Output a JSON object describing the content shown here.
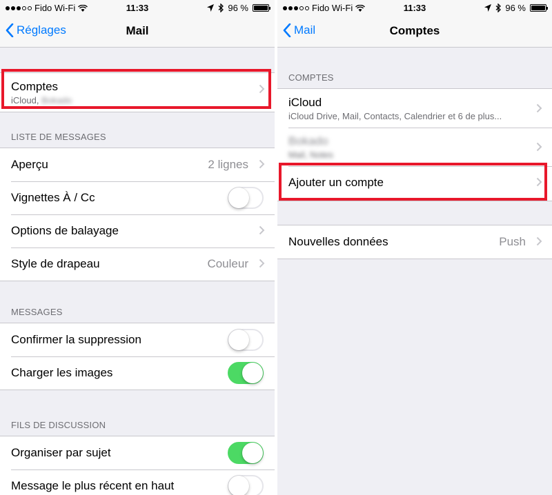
{
  "colors": {
    "accent": "#007aff",
    "switch_on": "#4cd964",
    "highlight": "#e8182b"
  },
  "left": {
    "status": {
      "carrier": "Fido Wi-Fi",
      "time": "11:33",
      "battery": "96 %",
      "battery_level": 0.96
    },
    "nav": {
      "back_label": "Réglages",
      "title": "Mail"
    },
    "accounts_row": {
      "label": "Comptes",
      "sublabel": "iCloud,",
      "sublabel_blurred": "Bokado"
    },
    "sections": {
      "message_list": {
        "header": "LISTE DE MESSAGES",
        "rows": [
          {
            "label": "Aperçu",
            "value": "2 lignes"
          },
          {
            "label": "Vignettes À / Cc",
            "toggle": false
          },
          {
            "label": "Options de balayage"
          },
          {
            "label": "Style de drapeau",
            "value": "Couleur"
          }
        ]
      },
      "messages": {
        "header": "MESSAGES",
        "rows": [
          {
            "label": "Confirmer la suppression",
            "toggle": false
          },
          {
            "label": "Charger les images",
            "toggle": true
          }
        ]
      },
      "threads": {
        "header": "FILS DE DISCUSSION",
        "rows": [
          {
            "label": "Organiser par sujet",
            "toggle": true
          },
          {
            "label": "Message le plus récent en haut",
            "toggle": false
          }
        ]
      }
    }
  },
  "right": {
    "status": {
      "carrier": "Fido Wi-Fi",
      "time": "11:33",
      "battery": "96 %",
      "battery_level": 0.96
    },
    "nav": {
      "back_label": "Mail",
      "title": "Comptes"
    },
    "accounts": {
      "header": "COMPTES",
      "icloud": {
        "label": "iCloud",
        "sublabel": "iCloud Drive, Mail, Contacts, Calendrier et 6 de plus..."
      },
      "blurred_account": {
        "label": "Bokado",
        "sublabel": "Mail, Notes"
      },
      "add_account": "Ajouter un compte"
    },
    "fetch": {
      "label": "Nouvelles données",
      "value": "Push"
    }
  }
}
